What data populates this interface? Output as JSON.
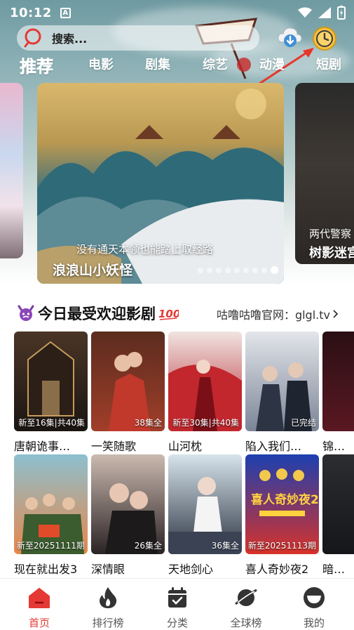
{
  "status": {
    "time": "10:12",
    "notif_glyph": "A"
  },
  "search": {
    "placeholder": "搜索..."
  },
  "tabs": [
    "推荐",
    "电影",
    "剧集",
    "综艺",
    "动漫",
    "短剧"
  ],
  "banner": {
    "left_poster": {
      "caption": ""
    },
    "main": {
      "subtitle": "没有通天本领也能踏上取经路",
      "title": "浪浪山小妖怪",
      "total_dots": 9,
      "active_dot": 8
    },
    "right": {
      "subtitle": "两代警察",
      "title": "树影迷宫"
    }
  },
  "section": {
    "title": "今日最受欢迎影剧",
    "emoji_left": "devil-face-icon",
    "emoji_right": "hundred-points-icon",
    "link": "咕噜咕噜官网：glgl.tv"
  },
  "row1": [
    {
      "title": "唐朝诡事…",
      "badge": "新至16集|共40集",
      "color_top": "#3a2a22",
      "color_bottom": "#1b1512"
    },
    {
      "title": "一笑随歌",
      "badge": "38集全",
      "color_top": "#5b2c1e",
      "color_bottom": "#a13e2a"
    },
    {
      "title": "山河枕",
      "badge": "新至30集|共40集",
      "color_top": "#e9d9d6",
      "color_bottom": "#b5202a"
    },
    {
      "title": "陷入我们…",
      "badge": "已完结",
      "color_top": "#d8dbe2",
      "color_bottom": "#3d4656"
    },
    {
      "title": "锦…",
      "badge": "",
      "color_top": "#2a0f14",
      "color_bottom": "#5a1822"
    }
  ],
  "row2": [
    {
      "title": "现在就出发3",
      "badge": "新至20251111期",
      "color_top": "#7fb7c8",
      "color_bottom": "#e07a30"
    },
    {
      "title": "深情眼",
      "badge": "26集全",
      "color_top": "#c9b8ae",
      "color_bottom": "#2a2224"
    },
    {
      "title": "天地剑心",
      "badge": "36集全",
      "color_top": "#cfdde6",
      "color_bottom": "#2c3442"
    },
    {
      "title": "喜人奇妙夜2",
      "badge": "新至20251113期",
      "color_top": "#1c3fb0",
      "color_bottom": "#d8322a"
    },
    {
      "title": "暗…",
      "badge": "",
      "color_top": "#2c2d31",
      "color_bottom": "#15161a"
    }
  ],
  "nav": [
    {
      "label": "首页",
      "icon": "home-icon",
      "active": true
    },
    {
      "label": "排行榜",
      "icon": "flame-icon",
      "active": false
    },
    {
      "label": "分类",
      "icon": "calendar-check-icon",
      "active": false
    },
    {
      "label": "全球榜",
      "icon": "planet-icon",
      "active": false
    },
    {
      "label": "我的",
      "icon": "profile-icon",
      "active": false
    }
  ],
  "colors": {
    "accent": "#e53935",
    "nav_inactive": "#333333"
  }
}
